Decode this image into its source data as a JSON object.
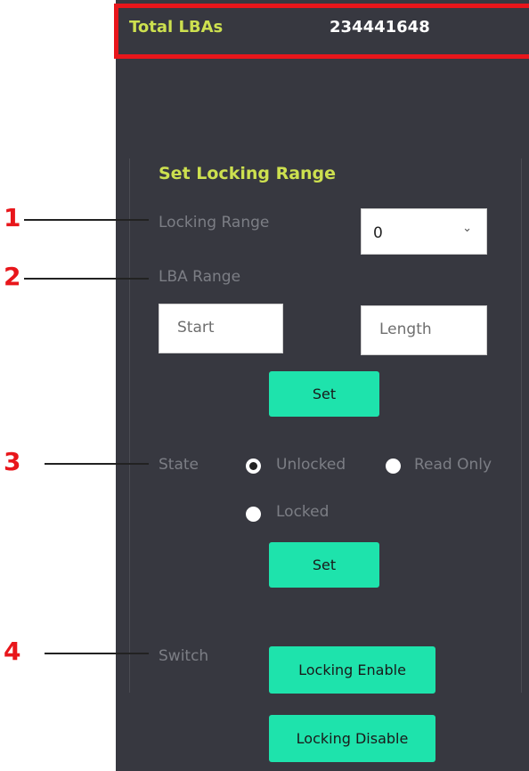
{
  "header": {
    "total_lbas_label": "Total LBAs",
    "total_lbas_value": "234441648"
  },
  "section": {
    "title": "Set Locking Range"
  },
  "locking_range": {
    "label": "Locking Range",
    "selected_value": "0"
  },
  "lba_range": {
    "label": "LBA Range",
    "start_placeholder": "Start",
    "length_placeholder": "Length",
    "set_label": "Set"
  },
  "state": {
    "label": "State",
    "options": [
      {
        "label": "Unlocked",
        "checked": true
      },
      {
        "label": "Read Only",
        "checked": false
      },
      {
        "label": "Locked",
        "checked": false
      }
    ],
    "set_label": "Set"
  },
  "switch": {
    "label": "Switch",
    "enable_label": "Locking Enable",
    "disable_label": "Locking Disable"
  },
  "callouts": [
    "1",
    "2",
    "3",
    "4"
  ],
  "colors": {
    "panel_bg": "#373840",
    "accent_text": "#cde04f",
    "button_bg": "#1ee3ac",
    "callout_red": "#e8161b"
  }
}
